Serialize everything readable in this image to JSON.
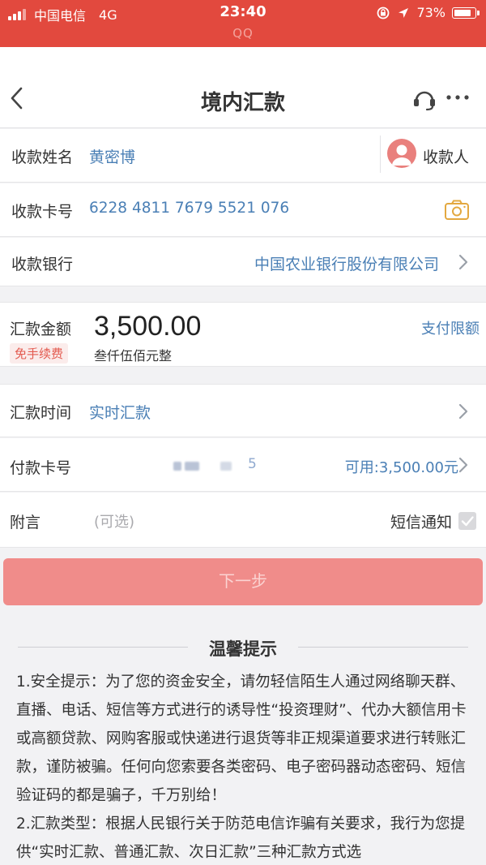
{
  "status_bar": {
    "carrier": "中国电信",
    "network": "4G",
    "time": "23:40",
    "app": "QQ",
    "battery": "73%"
  },
  "header": {
    "title": "境内汇款"
  },
  "payee": {
    "name_label": "收款姓名",
    "name_value": "黄密博",
    "payee_button": "收款人",
    "card_label": "收款卡号",
    "card_value": "6228 4811 7679 5521 076",
    "bank_label": "收款银行",
    "bank_value": "中国农业银行股份有限公司"
  },
  "amount": {
    "label": "汇款金额",
    "fee_badge": "免手续费",
    "value": "3,500.00",
    "value_cn": "叁仟伍佰元整",
    "limit_link": "支付限额"
  },
  "transfer": {
    "time_label": "汇款时间",
    "time_value": "实时汇款",
    "pay_card_label": "付款卡号",
    "pay_card_suffix": "5",
    "available": "可用:3,500.00元",
    "note_label": "附言",
    "note_placeholder": "(可选)",
    "sms_label": "短信通知"
  },
  "next_button": "下一步",
  "tips": {
    "title": "温馨提示",
    "p1": "1.安全提示：为了您的资金安全，请勿轻信陌生人通过网络聊天群、直播、电话、短信等方式进行的诱导性“投资理财”、代办大额信用卡或高额贷款、网购客服或快递进行退货等非正规渠道要求进行转账汇款，谨防被骗。任何向您索要各类密码、电子密码器动态密码、短信验证码的都是骗子，千万别给！",
    "p2": "2.汇款类型：根据人民银行关于防范电信诈骗有关要求，我行为您提供“实时汇款、普通汇款、次日汇款”三种汇款方式选"
  },
  "colors": {
    "status_bar": "#e2493e",
    "link_blue": "#4a7fb5",
    "button": "#f08c8a",
    "badge_red": "#e35a4f"
  }
}
